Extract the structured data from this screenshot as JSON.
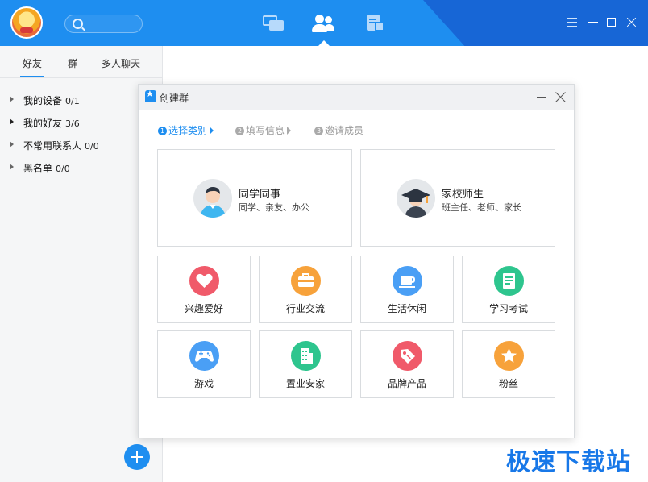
{
  "topbar": {
    "search_placeholder": "",
    "tabs": [
      {
        "icon": "message-icon",
        "selected": false
      },
      {
        "icon": "contacts-icon",
        "selected": true
      },
      {
        "icon": "documents-icon",
        "selected": false
      }
    ],
    "colors": {
      "bar": "#1e8ef0",
      "accent": "#1766d6"
    }
  },
  "left": {
    "tabs": [
      "好友",
      "群",
      "多人聊天"
    ],
    "groups": [
      {
        "name": "我的设备",
        "count": "0/1"
      },
      {
        "name": "我的好友",
        "count": "3/6"
      },
      {
        "name": "不常用联系人",
        "count": "0/0"
      },
      {
        "name": "黑名单",
        "count": "0/0"
      }
    ]
  },
  "dialog": {
    "title": "创建群",
    "steps": [
      {
        "num": "1",
        "label": "选择类别",
        "active": true
      },
      {
        "num": "2",
        "label": "填写信息",
        "active": false
      },
      {
        "num": "3",
        "label": "邀请成员",
        "active": false
      }
    ],
    "big_cards": [
      {
        "title": "同学同事",
        "subtitle": "同学、亲友、办公"
      },
      {
        "title": "家校师生",
        "subtitle": "班主任、老师、家长"
      }
    ],
    "categories": [
      {
        "label": "兴趣爱好",
        "icon": "heart-icon",
        "color": "#f05a6a"
      },
      {
        "label": "行业交流",
        "icon": "briefcase-icon",
        "color": "#f7a23b"
      },
      {
        "label": "生活休闲",
        "icon": "coffee-cup-icon",
        "color": "#4a9ff5"
      },
      {
        "label": "学习考试",
        "icon": "notebook-icon",
        "color": "#2ec58e"
      },
      {
        "label": "游戏",
        "icon": "gamepad-icon",
        "color": "#4a9ff5"
      },
      {
        "label": "置业安家",
        "icon": "building-icon",
        "color": "#2ec58e"
      },
      {
        "label": "品牌产品",
        "icon": "tag-icon",
        "color": "#f05a6a"
      },
      {
        "label": "粉丝",
        "icon": "star-icon",
        "color": "#f7a23b"
      }
    ]
  },
  "watermark": "极速下载站"
}
